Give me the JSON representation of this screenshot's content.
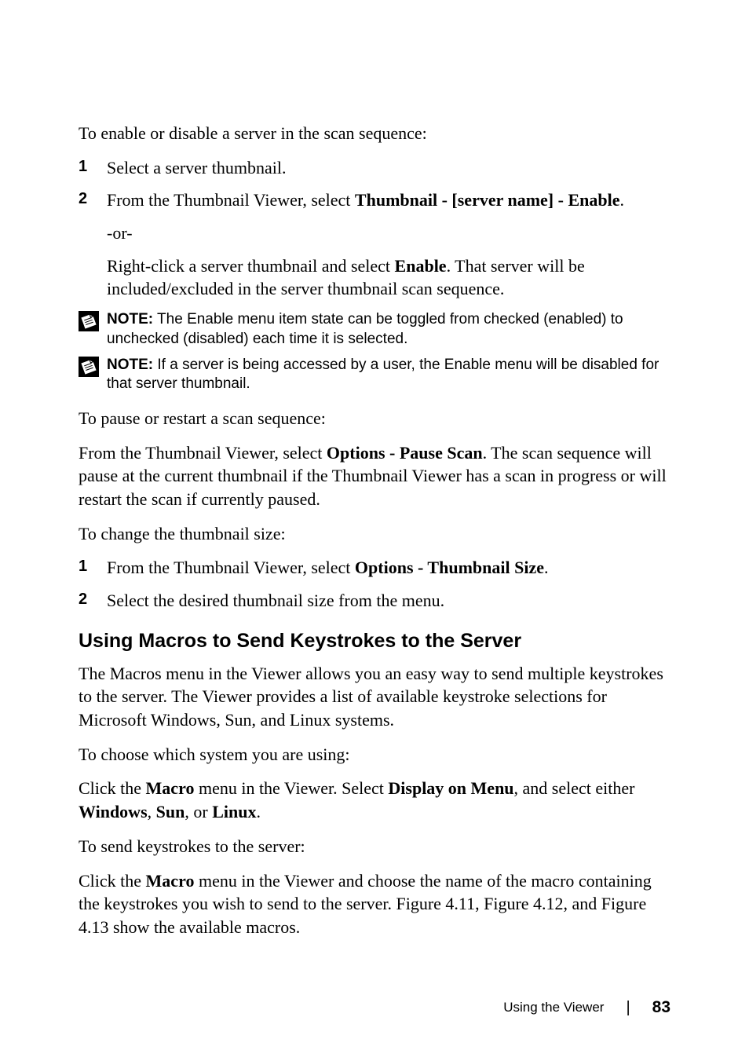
{
  "sec1": {
    "intro": "To enable or disable a server in the scan sequence:",
    "item1_num": "1",
    "item1": "Select a server thumbnail.",
    "item2_num": "2",
    "item2_pre": "From the Thumbnail Viewer, select ",
    "item2_bold": "Thumbnail - [server name] - Enable",
    "item2_post": ".",
    "or": "-or-",
    "right_pre": "Right-click a server thumbnail and select ",
    "right_bold": "Enable",
    "right_post": ". That server will be included/excluded in the server thumbnail scan sequence."
  },
  "note1": {
    "label": "NOTE:",
    "text": " The Enable menu item state can be toggled from checked (enabled) to unchecked (disabled) each time it is selected."
  },
  "note2": {
    "label": "NOTE:",
    "text": " If a server is being accessed by a user, the Enable menu will be disabled for that server thumbnail."
  },
  "sec2": {
    "intro": "To pause or restart a scan sequence:",
    "p_pre": "From the Thumbnail Viewer, select ",
    "p_bold": "Options - Pause Scan",
    "p_post": ". The scan sequence will pause at the current thumbnail if the Thumbnail Viewer has a scan in progress or will restart the scan if currently paused."
  },
  "sec3": {
    "intro": "To change the thumbnail size:",
    "item1_num": "1",
    "item1_pre": "From the Thumbnail Viewer, select ",
    "item1_bold": "Options - Thumbnail Size",
    "item1_post": ".",
    "item2_num": "2",
    "item2": "Select the desired thumbnail size from the menu."
  },
  "macros": {
    "heading": "Using Macros to Send Keystrokes to the Server",
    "p1": "The Macros menu in the Viewer allows you an easy way to send multiple keystrokes to the server. The Viewer provides a list of available keystroke selections for Microsoft Windows, Sun, and Linux systems.",
    "p2": "To choose which system you are using:",
    "p3_a": "Click the ",
    "p3_b": "Macro",
    "p3_c": " menu in the Viewer. Select ",
    "p3_d": "Display on Menu",
    "p3_e": ", and select either ",
    "p3_f": "Windows",
    "p3_g": ", ",
    "p3_h": "Sun",
    "p3_i": ", or ",
    "p3_j": "Linux",
    "p3_k": ".",
    "p4": "To send keystrokes to the server:",
    "p5_a": "Click the ",
    "p5_b": "Macro",
    "p5_c": " menu in the Viewer and choose the name of the macro containing the keystrokes you wish to send to the server. Figure 4.11, Figure 4.12, and Figure 4.13 show the available macros."
  },
  "footer": {
    "section": "Using the Viewer",
    "page": "83"
  }
}
